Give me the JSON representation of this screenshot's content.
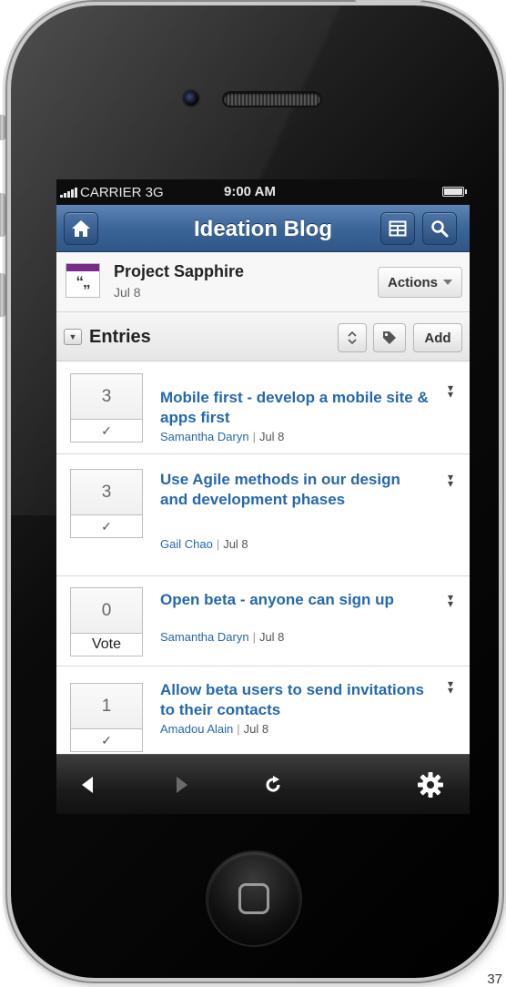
{
  "status_bar": {
    "carrier": "CARRIER 3G",
    "time": "9:00 AM"
  },
  "nav": {
    "title": "Ideation Blog",
    "home_icon": "home-icon",
    "view_icon": "layout-icon",
    "search_icon": "search-icon"
  },
  "project": {
    "name": "Project Sapphire",
    "date": "Jul 8",
    "actions_label": "Actions",
    "icon_glyph": "“„",
    "icon_color": "#7b2a8c"
  },
  "entries_section": {
    "label": "Entries",
    "add_label": "Add"
  },
  "entries": [
    {
      "votes": "3",
      "vote_action": "✓",
      "title": "Mobile first - develop a mobile site & apps first",
      "author": "Samantha Daryn",
      "date": "Jul 8"
    },
    {
      "votes": "3",
      "vote_action": "✓",
      "title": "Use Agile methods in our design and development phases",
      "author": "Gail Chao",
      "date": "Jul 8"
    },
    {
      "votes": "0",
      "vote_action": "Vote",
      "title": "Open beta - anyone can sign up",
      "author": "Samantha Daryn",
      "date": "Jul 8"
    },
    {
      "votes": "1",
      "vote_action": "✓",
      "title": "Allow beta users to send invitations to their contacts",
      "author": "Amadou Alain",
      "date": "Jul 8"
    }
  ],
  "meta_separator": "|",
  "page_number": "37",
  "colors": {
    "accent": "#2568ad",
    "navbar": "#3c6598"
  }
}
